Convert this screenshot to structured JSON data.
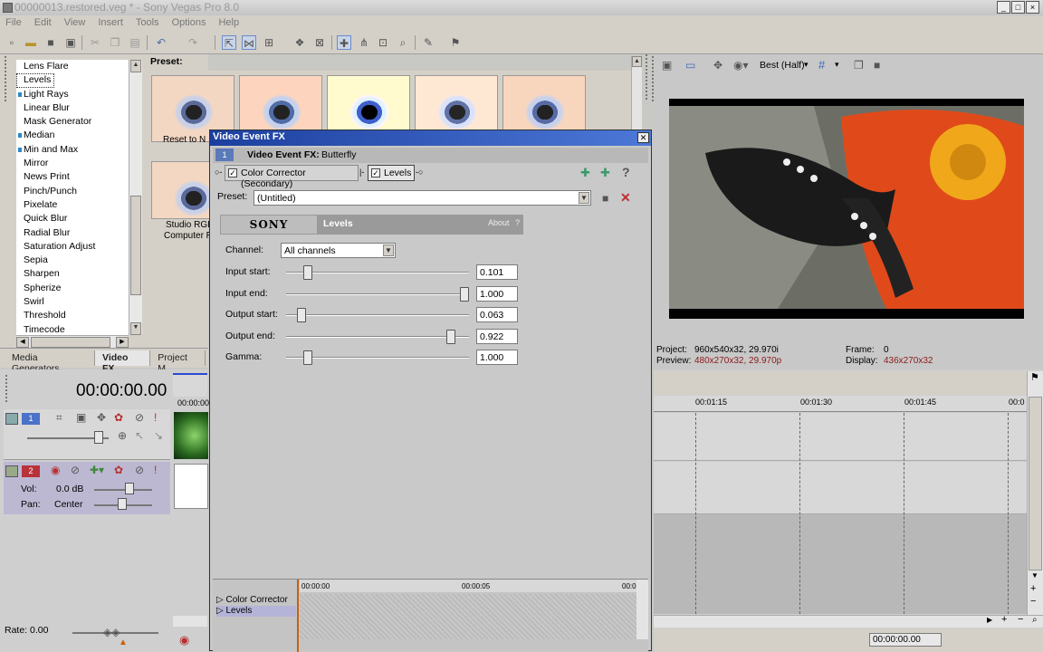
{
  "window": {
    "title": "00000013.restored.veg * - Sony Vegas Pro 8.0",
    "controls": [
      "_",
      "□",
      "×"
    ]
  },
  "menu": [
    "File",
    "Edit",
    "View",
    "Insert",
    "Tools",
    "Options",
    "Help"
  ],
  "fx_list": {
    "items": [
      {
        "label": "Lens Flare",
        "marked": false
      },
      {
        "label": "Levels",
        "marked": false,
        "selected": true
      },
      {
        "label": "Light Rays",
        "marked": true
      },
      {
        "label": "Linear Blur",
        "marked": false
      },
      {
        "label": "Mask Generator",
        "marked": false
      },
      {
        "label": "Median",
        "marked": true
      },
      {
        "label": "Min and Max",
        "marked": true
      },
      {
        "label": "Mirror",
        "marked": false
      },
      {
        "label": "News Print",
        "marked": false
      },
      {
        "label": "Pinch/Punch",
        "marked": false
      },
      {
        "label": "Pixelate",
        "marked": false
      },
      {
        "label": "Quick Blur",
        "marked": false
      },
      {
        "label": "Radial Blur",
        "marked": false
      },
      {
        "label": "Saturation Adjust",
        "marked": false
      },
      {
        "label": "Sepia",
        "marked": false
      },
      {
        "label": "Sharpen",
        "marked": false
      },
      {
        "label": "Spherize",
        "marked": false
      },
      {
        "label": "Swirl",
        "marked": false
      },
      {
        "label": "Threshold",
        "marked": false
      },
      {
        "label": "Timecode",
        "marked": false
      }
    ]
  },
  "preset_panel": {
    "label": "Preset:",
    "captions": [
      "Reset to N",
      "Studio RGB",
      "Computer R"
    ]
  },
  "window_tabs": [
    "Media Generators",
    "Video FX",
    "Project M"
  ],
  "timeline_header": {
    "time": "00:00:00.00",
    "ruler_start": "00:00:00"
  },
  "track1": {
    "number": "1"
  },
  "track2": {
    "number": "2",
    "vol_label": "Vol:",
    "vol_value": "0.0 dB",
    "pan_label": "Pan:",
    "pan_value": "Center"
  },
  "rate": {
    "label": "Rate: 0.00"
  },
  "dialog": {
    "title": "Video Event FX",
    "event_label": "Video Event FX:",
    "event_name": "Butterfly",
    "chain": [
      {
        "label": "Color Corrector (Secondary)",
        "checked": true
      },
      {
        "label": "Levels",
        "checked": true
      }
    ],
    "preset_label": "Preset:",
    "preset_value": "(Untitled)",
    "brand": "SONY",
    "plugin_name": "Levels",
    "about": "About",
    "help": "?",
    "channel_label": "Channel:",
    "channel_value": "All channels",
    "params": [
      {
        "label": "Input start:",
        "value": "0.101",
        "level": 0.101
      },
      {
        "label": "Input end:",
        "value": "1.000",
        "level": 1.0
      },
      {
        "label": "Output start:",
        "value": "0.063",
        "level": 0.063
      },
      {
        "label": "Output end:",
        "value": "0.922",
        "level": 0.922
      },
      {
        "label": "Gamma:",
        "value": "1.000",
        "level": 0.1
      }
    ],
    "keyframes": {
      "rows": [
        "Color Corrector",
        "Levels"
      ],
      "ruler": [
        "00:00:00",
        "00:00:05",
        "00:0"
      ]
    }
  },
  "preview": {
    "quality": "Best (Half)",
    "project_label": "Project:",
    "project_value": "960x540x32, 29.970i",
    "preview_label": "Preview:",
    "preview_value": "480x270x32, 29.970p",
    "frame_label": "Frame:",
    "frame_value": "0",
    "display_label": "Display:",
    "display_value": "436x270x32",
    "accent_color": "#8b1a1a"
  },
  "main_timeline": {
    "ruler": [
      "00:01:15",
      "00:01:30",
      "00:01:45",
      "00:0"
    ],
    "status_time": "00:00:00.00"
  }
}
